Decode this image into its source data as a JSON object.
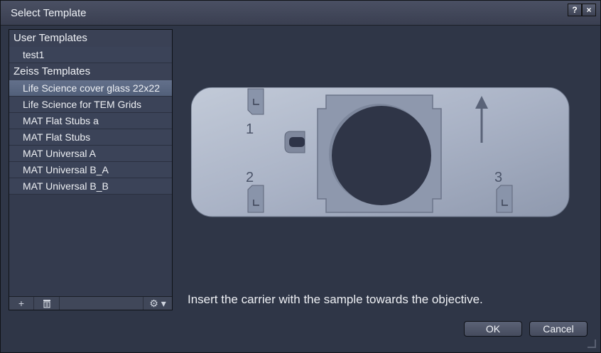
{
  "window": {
    "title": "Select Template",
    "help_label": "?",
    "close_label": "×"
  },
  "templates": {
    "groups": [
      {
        "header": "User Templates",
        "items": [
          "test1"
        ]
      },
      {
        "header": "Zeiss Templates",
        "items": [
          "Life Science cover glass 22x22",
          "Life Science for TEM Grids",
          "MAT Flat Stubs a",
          "MAT Flat Stubs",
          "MAT Universal A",
          "MAT Universal B_A",
          "MAT Universal B_B"
        ]
      }
    ],
    "selected": "Life Science cover glass 22x22",
    "toolbar": {
      "add_label": "+",
      "delete_label": "🗑",
      "settings_label": "⚙ ▾"
    }
  },
  "preview": {
    "position_labels": [
      "1",
      "2",
      "3"
    ],
    "instruction": "Insert the carrier with the sample towards the objective."
  },
  "buttons": {
    "ok": "OK",
    "cancel": "Cancel"
  }
}
